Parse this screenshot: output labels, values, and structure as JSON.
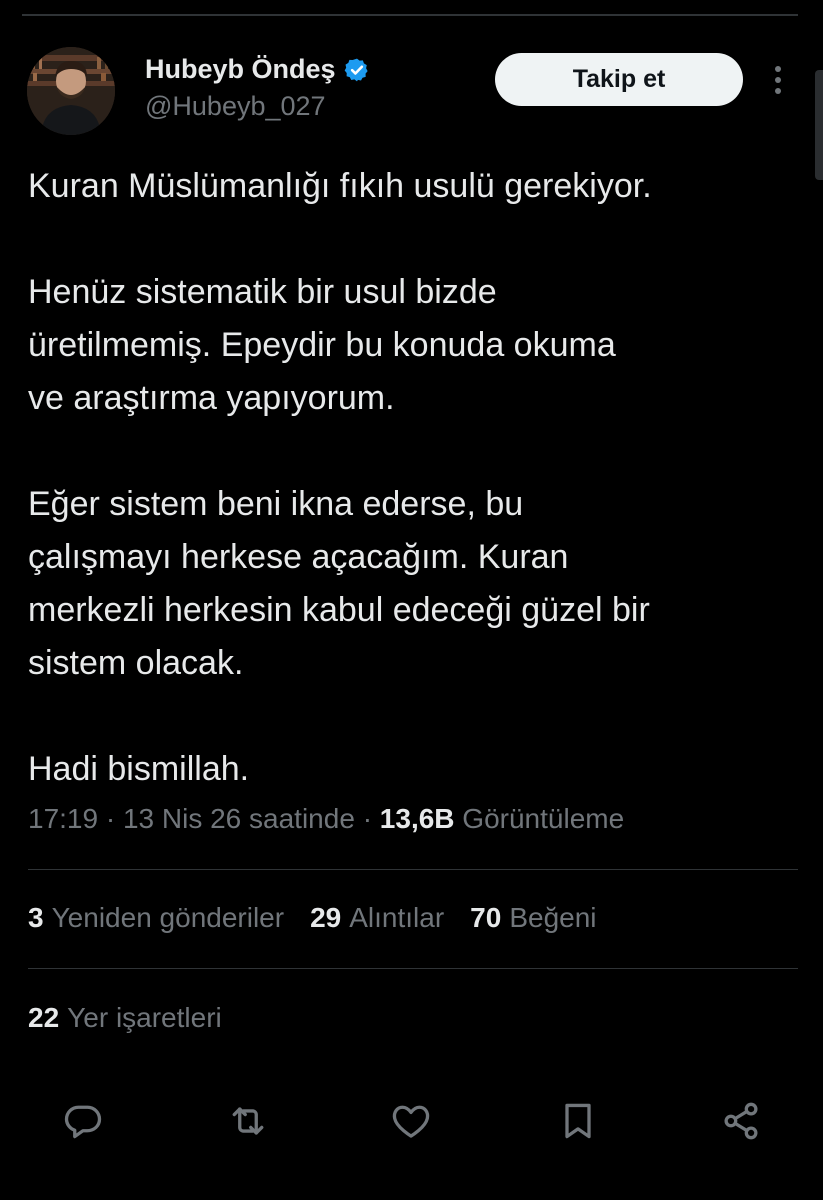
{
  "author": {
    "name": "Hubeyb Öndeş",
    "handle": "@Hubeyb_027",
    "verified_icon": "verified-badge-icon",
    "verified_color": "#1d9bf0"
  },
  "follow_button": {
    "label": "Takip et"
  },
  "more_menu": {
    "icon": "more-vertical-icon"
  },
  "tweet": {
    "paragraphs": [
      "Kuran Müslümanlığı fıkıh usulü gerekiyor.",
      "Henüz sistematik bir usul bizde\nüretilmemiş. Epeydir bu konuda okuma\nve araştırma yapıyorum.",
      "Eğer sistem beni ikna ederse, bu\nçalışmayı herkese açacağım. Kuran\nmerkezli herkesin kabul edeceği güzel bir\nsistem olacak.",
      "Hadi bismillah."
    ]
  },
  "meta": {
    "time": "17:19",
    "separator": "·",
    "date": "13 Nis 26 saatinde",
    "views_count": "13,6B",
    "views_label": "Görüntüleme"
  },
  "stats": {
    "reposts": {
      "count": "3",
      "label": "Yeniden gönderiler"
    },
    "quotes": {
      "count": "29",
      "label": "Alıntılar"
    },
    "likes": {
      "count": "70",
      "label": "Beğeni"
    },
    "bookmarks": {
      "count": "22",
      "label": "Yer işaretleri"
    }
  },
  "actions": [
    {
      "name": "reply",
      "icon": "reply-icon"
    },
    {
      "name": "repost",
      "icon": "repost-icon"
    },
    {
      "name": "like",
      "icon": "heart-icon"
    },
    {
      "name": "bookmark",
      "icon": "bookmark-icon"
    },
    {
      "name": "share",
      "icon": "share-icon"
    }
  ],
  "colors": {
    "background": "#000000",
    "text_primary": "#e7e9ea",
    "text_secondary": "#71767b",
    "divider": "#2f3336",
    "button_bg": "#eff3f4",
    "button_text": "#0f1419"
  }
}
